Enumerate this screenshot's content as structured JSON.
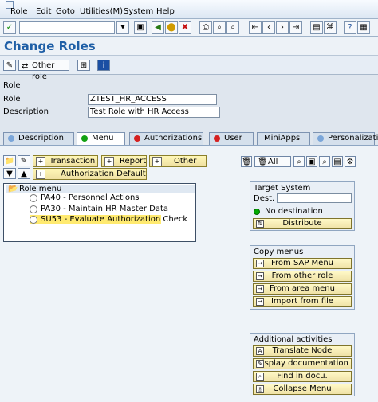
{
  "menubar": {
    "items": [
      "Role",
      "Edit",
      "Goto",
      "Utilities(M)",
      "System",
      "Help"
    ]
  },
  "toolbar": {
    "command_value": "",
    "icons": [
      "check-icon",
      "dropdown-icon",
      "save-icon",
      "back-icon",
      "exit-icon",
      "cancel-icon",
      "print-icon",
      "find-icon",
      "find-next-icon",
      "first-page-icon",
      "prev-page-icon",
      "next-page-icon",
      "last-page-icon",
      "new-session-icon",
      "shortcut-icon",
      "help-icon",
      "layout-icon"
    ]
  },
  "page": {
    "title": "Change Roles",
    "app_toolbar_other_role": "Other role"
  },
  "role_section": {
    "header": "Role",
    "role_label": "Role",
    "role_value": "ZTEST_HR_ACCESS",
    "description_label": "Description",
    "description_value": "Test Role with HR Access"
  },
  "tabs": [
    {
      "label": "Description"
    },
    {
      "label": "Menu"
    },
    {
      "label": "Authorizations"
    },
    {
      "label": "User"
    },
    {
      "label": "MiniApps"
    },
    {
      "label": "Personalization"
    }
  ],
  "menu_toolbar": {
    "transaction": "Transaction",
    "report": "Report",
    "other": "Other",
    "authorization_default": "Authorization Default",
    "all": "All"
  },
  "tree": {
    "root": "Role menu",
    "items": [
      "PA40 - Personnel Actions",
      "PA30 - Maintain HR Master Data",
      "SU53 - Evaluate Authorization Check"
    ]
  },
  "target_system": {
    "title": "Target System",
    "dest_label": "Dest.",
    "dest_value": "",
    "status": "No destination",
    "distribute": "Distribute"
  },
  "copy_menus": {
    "title": "Copy menus",
    "items": [
      "From SAP Menu",
      "From other role",
      "From area menu",
      "Import from file"
    ]
  },
  "additional_activities": {
    "title": "Additional activities",
    "items": [
      "Translate Node",
      "Display documentation",
      "Find in docu.",
      "Collapse Menu"
    ]
  },
  "colors": {
    "title_blue": "#1f5fa6",
    "accent_yellow": "#ffea70",
    "status_green": "#00aa00"
  }
}
